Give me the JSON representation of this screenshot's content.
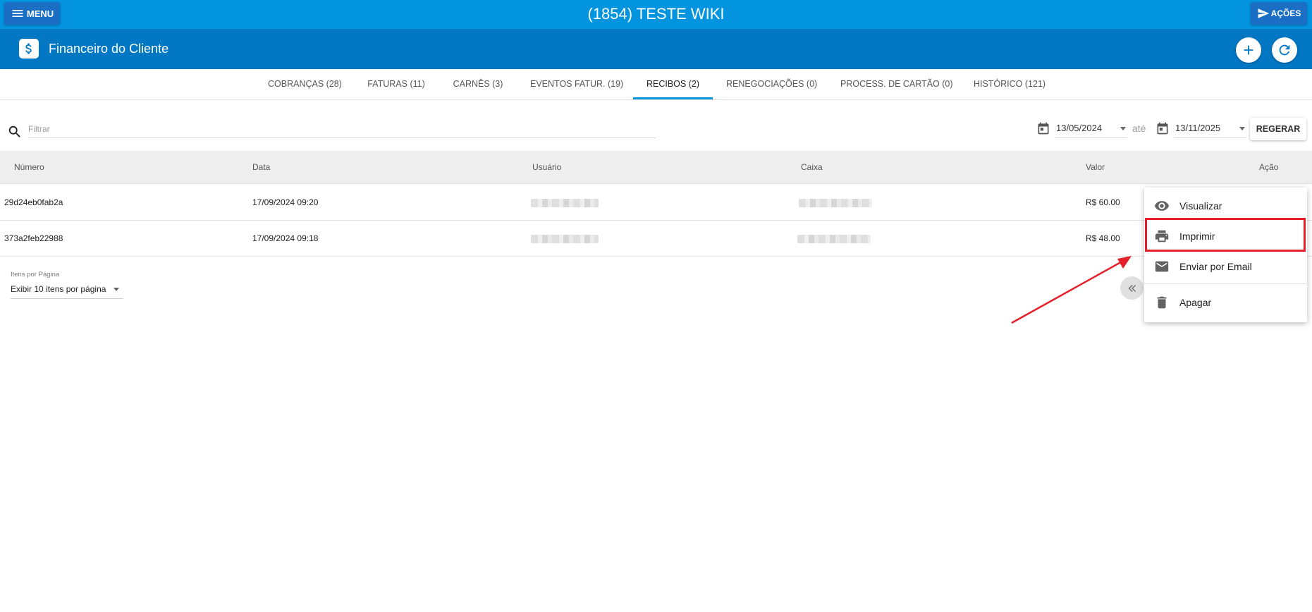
{
  "topbar": {
    "menu_label": "MENU",
    "title": "(1854) TESTE WIKI",
    "acoes_label": "AÇÕES"
  },
  "subheader": {
    "title": "Financeiro do Cliente"
  },
  "tabs": [
    {
      "label": "COBRANÇAS (28)"
    },
    {
      "label": "FATURAS (11)"
    },
    {
      "label": "CARNÊS (3)"
    },
    {
      "label": "EVENTOS FATUR. (19)"
    },
    {
      "label": "RECIBOS (2)",
      "active": true
    },
    {
      "label": "RENEGOCIAÇÕES (0)"
    },
    {
      "label": "PROCESS. DE CARTÃO (0)"
    },
    {
      "label": "HISTÓRICO (121)"
    }
  ],
  "filter": {
    "placeholder": "Filtrar",
    "date_from": "13/05/2024",
    "date_separator": "até",
    "date_to": "13/11/2025",
    "regerar_label": "REGERAR"
  },
  "table": {
    "headers": [
      "Número",
      "Data",
      "Usuário",
      "Caixa",
      "Valor",
      "Ação"
    ],
    "rows": [
      {
        "numero": "29d24eb0fab2a",
        "data": "17/09/2024 09:20",
        "valor": "R$ 60.00"
      },
      {
        "numero": "373a2feb22988",
        "data": "17/09/2024 09:18",
        "valor": "R$ 48.00"
      }
    ]
  },
  "pagination": {
    "label": "Itens por Página",
    "selected": "Exibir 10 itens por página"
  },
  "action_menu": {
    "items": [
      {
        "label": "Visualizar",
        "icon": "eye-icon"
      },
      {
        "label": "Imprimir",
        "icon": "printer-icon"
      },
      {
        "label": "Enviar por Email",
        "icon": "mail-icon"
      },
      {
        "label": "Apagar",
        "icon": "trash-icon"
      }
    ]
  },
  "colors": {
    "topbar": "#0394e0",
    "subheader": "#0277c4",
    "button": "#1a6fc4",
    "highlight": "#e5202a",
    "tab_indicator": "#0394e0"
  }
}
